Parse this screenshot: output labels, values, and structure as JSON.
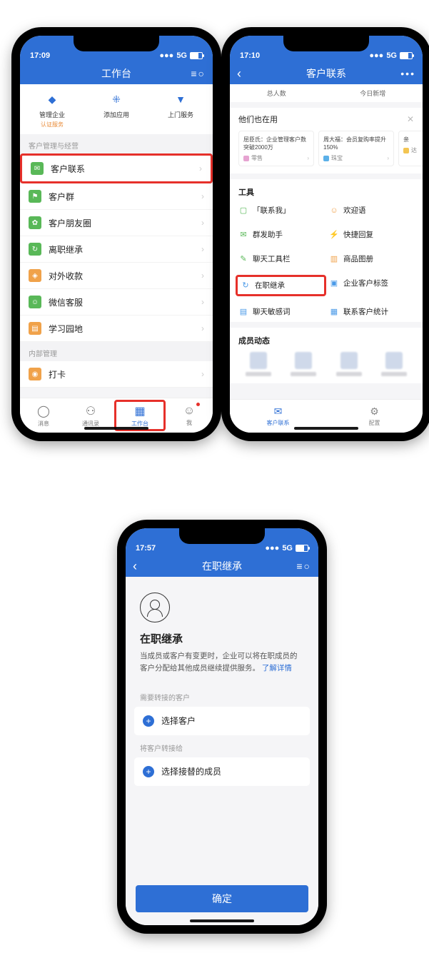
{
  "status": {
    "t1": "17:09",
    "t2": "17:10",
    "t3": "17:57",
    "signal": "5G"
  },
  "p1": {
    "title": "工作台",
    "top": [
      {
        "label": "管理企业",
        "sub": "认证服务"
      },
      {
        "label": "添加应用",
        "sub": ""
      },
      {
        "label": "上门服务",
        "sub": ""
      }
    ],
    "sec1": "客户管理与经营",
    "rows1": [
      "客户联系",
      "客户群",
      "客户朋友圈",
      "离职继承",
      "对外收款",
      "微信客服",
      "学习园地"
    ],
    "sec2": "内部管理",
    "rows2": [
      "打卡"
    ],
    "tabs": [
      "消息",
      "通讯录",
      "工作台",
      "我"
    ]
  },
  "p2": {
    "title": "客户联系",
    "stats": [
      "总人数",
      "今日新增"
    ],
    "also": "他们也在用",
    "cards": [
      {
        "text": "屈臣氏：企业管理客户数突破2000万",
        "tag": "零售"
      },
      {
        "text": "周大福：会员复购率提升150%",
        "tag": "珠宝"
      },
      {
        "text": "亲",
        "tag": "达"
      }
    ],
    "tools_h": "工具",
    "tools": [
      [
        "「联系我」",
        "欢迎语"
      ],
      [
        "群发助手",
        "快捷回复"
      ],
      [
        "聊天工具栏",
        "商品图册"
      ],
      [
        "在职继承",
        "企业客户标签"
      ],
      [
        "聊天敏感词",
        "联系客户统计"
      ]
    ],
    "members_h": "成员动态",
    "btabs": [
      "客户联系",
      "配置"
    ]
  },
  "p3": {
    "title": "在职继承",
    "h": "在职继承",
    "desc": "当成员或客户有变更时，企业可以将在职成员的客户分配给其他成员继续提供服务。",
    "link": "了解详情",
    "lbl1": "需要转接的客户",
    "sel1": "选择客户",
    "lbl2": "将客户转接给",
    "sel2": "选择接替的成员",
    "confirm": "确定"
  },
  "colors": {
    "row_icons": [
      "#59b858",
      "#59b858",
      "#59b858",
      "#59b858",
      "#f0a24a",
      "#59b858",
      "#f0a24a",
      "#f0a24a"
    ]
  }
}
